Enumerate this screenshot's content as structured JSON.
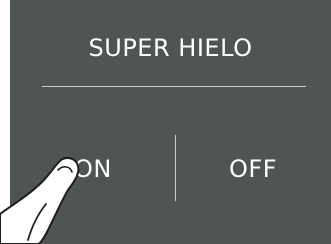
{
  "control": {
    "title": "SUPER HIELO",
    "on_label": "ON",
    "off_label": "OFF"
  },
  "colors": {
    "panel_background": "#4f5455",
    "text": "#ffffff",
    "divider": "#c9cccd"
  },
  "icons": {
    "pointer": "finger-tap-icon"
  }
}
